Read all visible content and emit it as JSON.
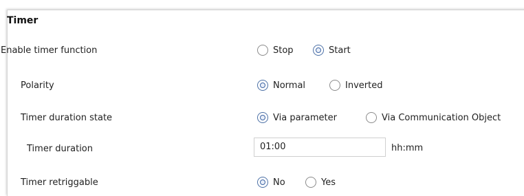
{
  "section": {
    "title": "Timer"
  },
  "rows": {
    "enable": {
      "label": "Enable timer function",
      "opt1": "Stop",
      "opt2": "Start",
      "selected": "Start"
    },
    "polarity": {
      "label": "Polarity",
      "opt1": "Normal",
      "opt2": "Inverted",
      "selected": "Normal"
    },
    "duration_state": {
      "label": "Timer duration state",
      "opt1": "Via parameter",
      "opt2": "Via Communication Object",
      "selected": "Via parameter"
    },
    "duration": {
      "label": "Timer duration",
      "value": "01:00",
      "unit": "hh:mm"
    },
    "retrig": {
      "label": "Timer retriggable",
      "opt1": "No",
      "opt2": "Yes",
      "selected": "No"
    }
  }
}
